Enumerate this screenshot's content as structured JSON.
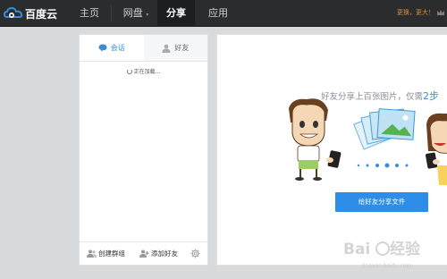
{
  "brand": {
    "logo_text": "百度云"
  },
  "nav": {
    "items": [
      {
        "label": "主页"
      },
      {
        "label": "网盘"
      },
      {
        "label": "分享"
      },
      {
        "label": "应用"
      }
    ],
    "active": "分享"
  },
  "user": {
    "text": "更换，更大！"
  },
  "left_panel": {
    "tabs": [
      {
        "label": "会话",
        "icon": "chat-bubble-icon"
      },
      {
        "label": "好友",
        "icon": "person-icon"
      }
    ],
    "loading_text": "正在加载...",
    "footer": {
      "create_group": "创建群组",
      "add_friend": "添加好友"
    }
  },
  "right_panel": {
    "promo_prefix": "好友分享上百张图片，仅需",
    "promo_highlight": "2步",
    "share_button": "给好友分享文件"
  },
  "watermark": {
    "text": "Baidu 经验",
    "sub": "jingyan.baidu.com"
  },
  "colors": {
    "accent": "#2d8de8",
    "topbar": "#2b2c2e",
    "background": "#d9dadc"
  }
}
